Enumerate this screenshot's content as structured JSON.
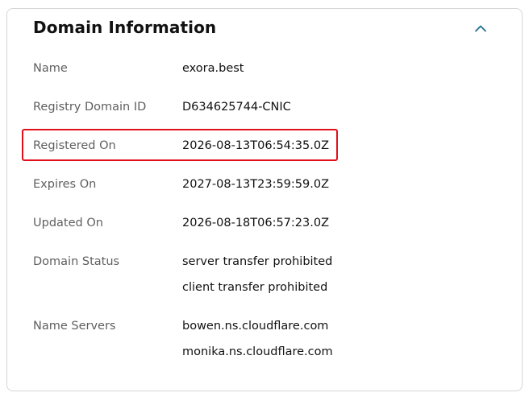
{
  "card": {
    "title": "Domain Information",
    "collapse_icon": "chevron-up-icon",
    "accent_color": "#1f6f8b",
    "highlight_color": "#e0101b"
  },
  "fields": {
    "name": {
      "label": "Name",
      "value": "exora.best"
    },
    "registry_domain_id": {
      "label": "Registry Domain ID",
      "value": "D634625744-CNIC"
    },
    "registered_on": {
      "label": "Registered On",
      "value": "2026-08-13T06:54:35.0Z"
    },
    "expires_on": {
      "label": "Expires On",
      "value": "2027-08-13T23:59:59.0Z"
    },
    "updated_on": {
      "label": "Updated On",
      "value": "2026-08-18T06:57:23.0Z"
    },
    "domain_status": {
      "label": "Domain Status",
      "values": [
        "server transfer prohibited",
        "client transfer prohibited"
      ]
    },
    "name_servers": {
      "label": "Name Servers",
      "values": [
        "bowen.ns.cloudflare.com",
        "monika.ns.cloudflare.com"
      ]
    }
  }
}
